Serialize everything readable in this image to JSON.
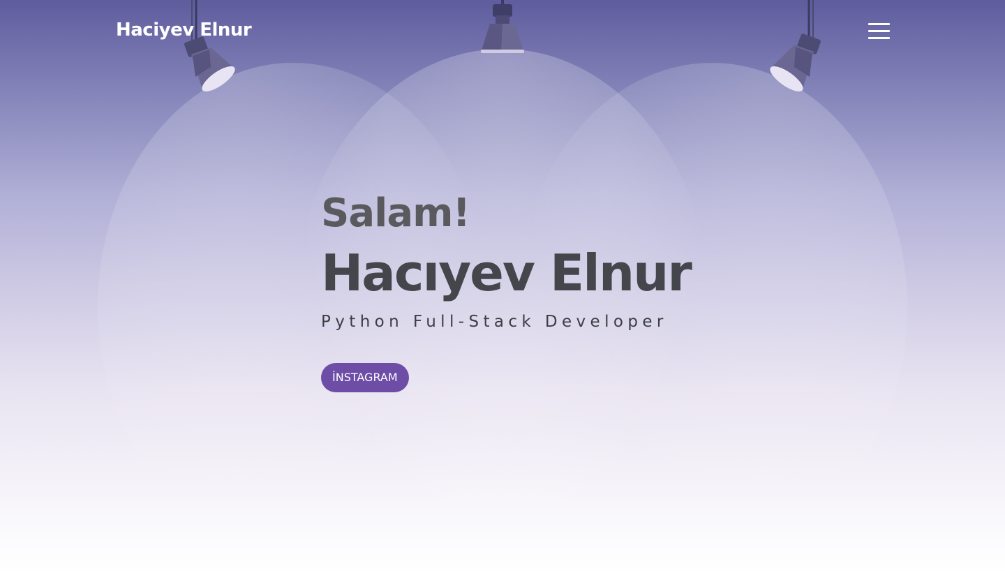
{
  "nav": {
    "brand": "Haciyev Elnur",
    "menu_icon": "hamburger-menu-icon"
  },
  "hero": {
    "greeting": "Salam!",
    "name": "Hacıyev Elnur",
    "role": "Python Full-Stack Developer",
    "cta_label": "İNSTAGRAM"
  },
  "colors": {
    "accent": "#6d4da6",
    "heading": "#44464c",
    "greeting": "#5a5a5e",
    "sky_top": "#5f5c9d",
    "background_bottom": "#ffffff"
  },
  "decorations": {
    "lamps": [
      "spotlight-icon",
      "spotlight-icon",
      "spotlight-icon"
    ]
  }
}
